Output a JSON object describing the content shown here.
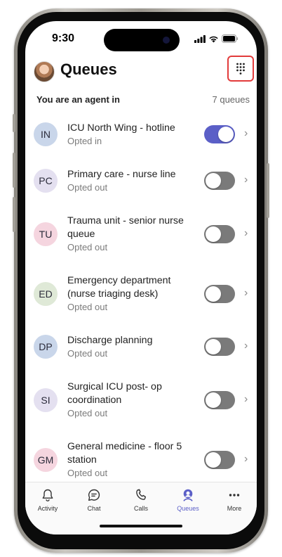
{
  "status_bar": {
    "time": "9:30"
  },
  "header": {
    "title": "Queues"
  },
  "subheader": {
    "agent_label": "You are an agent in",
    "queue_count": "7 queues"
  },
  "queues": [
    {
      "initials": "IN",
      "name_lines": [
        "ICU North Wing - hotline"
      ],
      "status": "Opted in",
      "opted_in": true,
      "color": "#c9d6ea"
    },
    {
      "initials": "PC",
      "name_lines": [
        "Primary care - nurse line"
      ],
      "status": "Opted out",
      "opted_in": false,
      "color": "#e4e0f0"
    },
    {
      "initials": "TU",
      "name_lines": [
        "Trauma unit - senior nurse",
        "queue"
      ],
      "status": "Opted out",
      "opted_in": false,
      "color": "#f5d5df"
    },
    {
      "initials": "ED",
      "name_lines": [
        "Emergency department",
        "(nurse triaging desk)"
      ],
      "status": "Opted out",
      "opted_in": false,
      "color": "#dfe9d7"
    },
    {
      "initials": "DP",
      "name_lines": [
        "Discharge planning"
      ],
      "status": "Opted out",
      "opted_in": false,
      "color": "#c9d6ea"
    },
    {
      "initials": "SI",
      "name_lines": [
        "Surgical ICU post- op",
        "coordination"
      ],
      "status": "Opted out",
      "opted_in": false,
      "color": "#e4e0f0"
    },
    {
      "initials": "GM",
      "name_lines": [
        "General medicine - floor 5",
        "station"
      ],
      "status": "Opted out",
      "opted_in": false,
      "color": "#f5d5df"
    }
  ],
  "tabs": [
    {
      "label": "Activity",
      "icon": "bell-icon",
      "active": false
    },
    {
      "label": "Chat",
      "icon": "chat-icon",
      "active": false
    },
    {
      "label": "Calls",
      "icon": "phone-icon",
      "active": false
    },
    {
      "label": "Queues",
      "icon": "headset-icon",
      "active": true
    },
    {
      "label": "More",
      "icon": "more-icon",
      "active": false
    }
  ],
  "colors": {
    "accent": "#5b5fc7",
    "highlight_border": "#e23b3b"
  }
}
